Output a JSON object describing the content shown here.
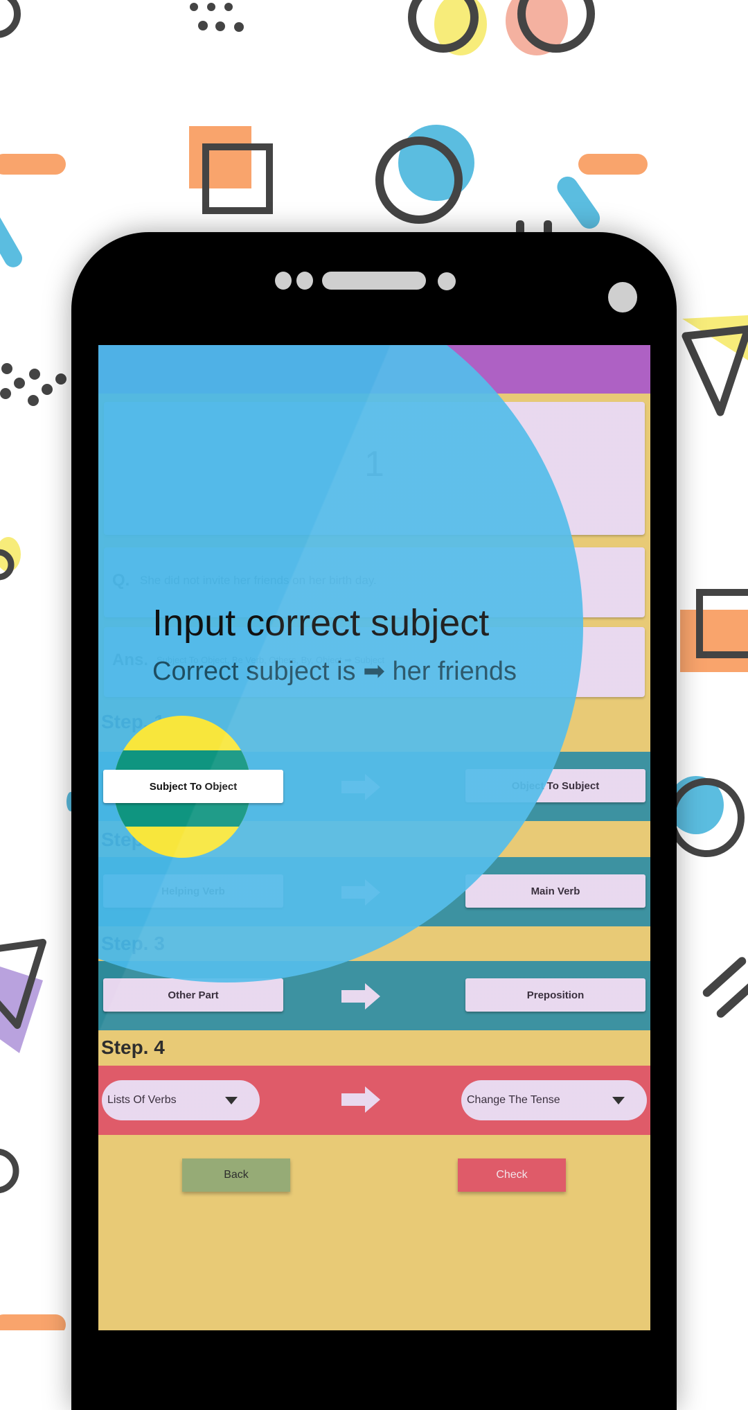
{
  "screen": {
    "question_number": "1",
    "question": {
      "label": "Q.",
      "text": "She did not invite her friends on her birth day."
    },
    "answer": {
      "label": "Ans.",
      "text": "Subject To Object, Be Verb, Others, By, Object ➡ Subject"
    },
    "steps": [
      {
        "label": "Step. 1",
        "left": "Subject To Object",
        "right": "Object To Subject",
        "row_color": "#2e8a9a"
      },
      {
        "label": "Step. 2",
        "left": "Helping Verb",
        "right": "Main Verb",
        "row_color": "#2e8a9a"
      },
      {
        "label": "Step. 3",
        "left": "Other Part",
        "right": "Preposition",
        "row_color": "#2e8a9a"
      },
      {
        "label": "Step. 4",
        "left": "Lists Of Verbs",
        "right": "Change The Tense",
        "row_color": "#dd4f5e"
      }
    ],
    "buttons": {
      "back": "Back",
      "check": "Check"
    }
  },
  "tutorial_overlay": {
    "title": "Input correct subject",
    "description": "Correct subject is ➡ her friends",
    "highlighted_target": "Subject To Object"
  },
  "colors": {
    "topbar": "#a855c0",
    "background": "#e6c66c",
    "card": "#e7d6ee",
    "overlay": "#48b8e8",
    "back_button": "#8ea56c",
    "check_button": "#dd4f5e"
  }
}
